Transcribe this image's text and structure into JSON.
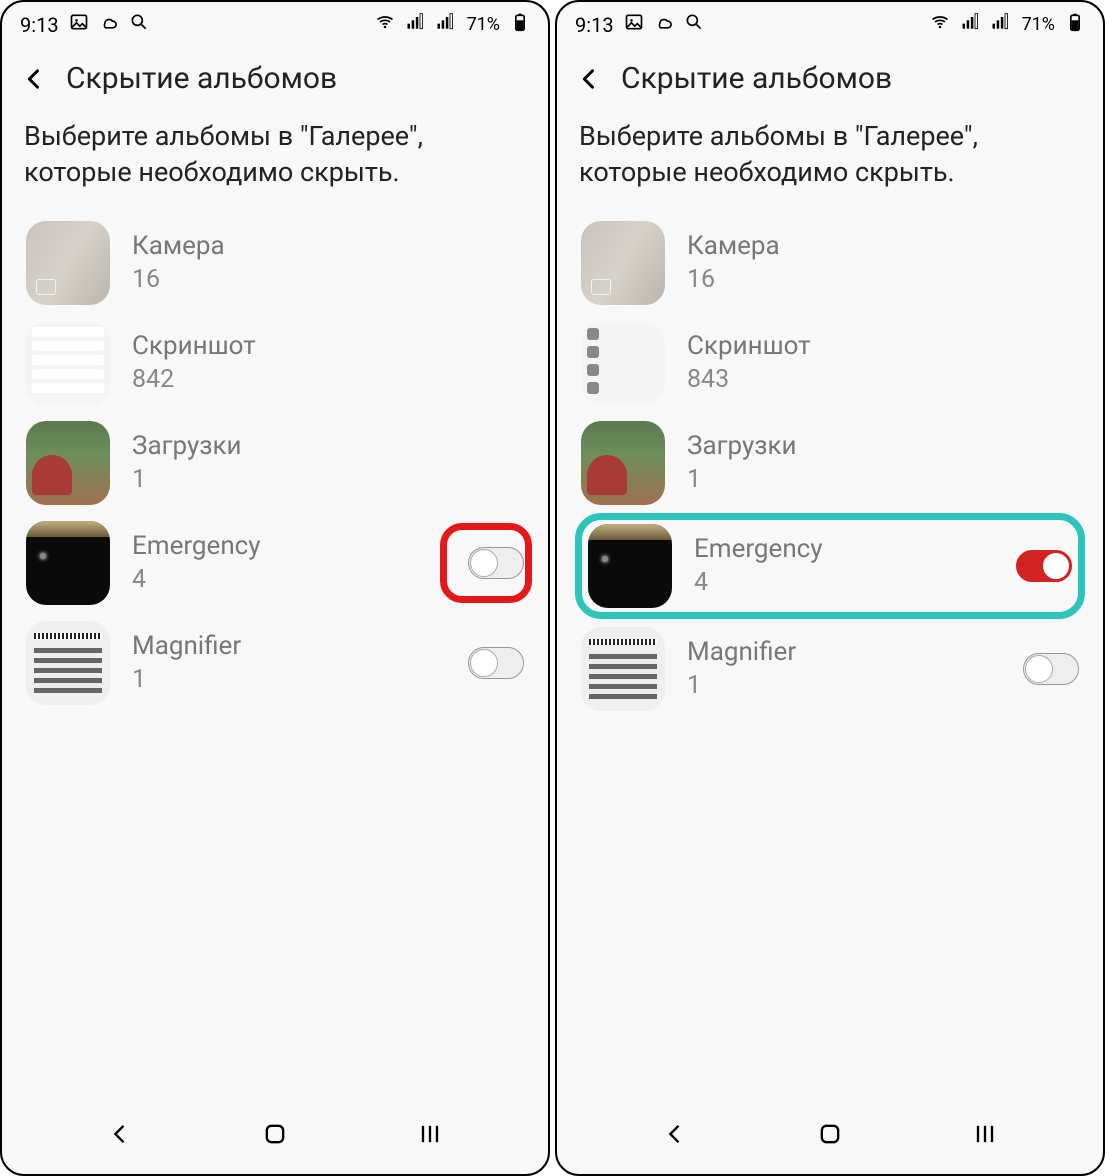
{
  "status": {
    "time": "9:13",
    "battery": "71%"
  },
  "header": {
    "title": "Скрытие альбомов"
  },
  "subtitle": "Выберите альбомы в \"Галерее\", которые необходимо скрыть.",
  "screens": [
    {
      "albums": [
        {
          "name": "Камера",
          "count": "16",
          "toggle": null
        },
        {
          "name": "Скриншот",
          "count": "842",
          "toggle": null
        },
        {
          "name": "Загрузки",
          "count": "1",
          "toggle": null
        },
        {
          "name": "Emergency",
          "count": "4",
          "toggle": "off",
          "highlight": "red"
        },
        {
          "name": "Magnifier",
          "count": "1",
          "toggle": "off"
        }
      ]
    },
    {
      "albums": [
        {
          "name": "Камера",
          "count": "16",
          "toggle": null
        },
        {
          "name": "Скриншот",
          "count": "843",
          "toggle": null
        },
        {
          "name": "Загрузки",
          "count": "1",
          "toggle": null
        },
        {
          "name": "Emergency",
          "count": "4",
          "toggle": "on",
          "highlight": "teal"
        },
        {
          "name": "Magnifier",
          "count": "1",
          "toggle": "off"
        }
      ]
    }
  ]
}
